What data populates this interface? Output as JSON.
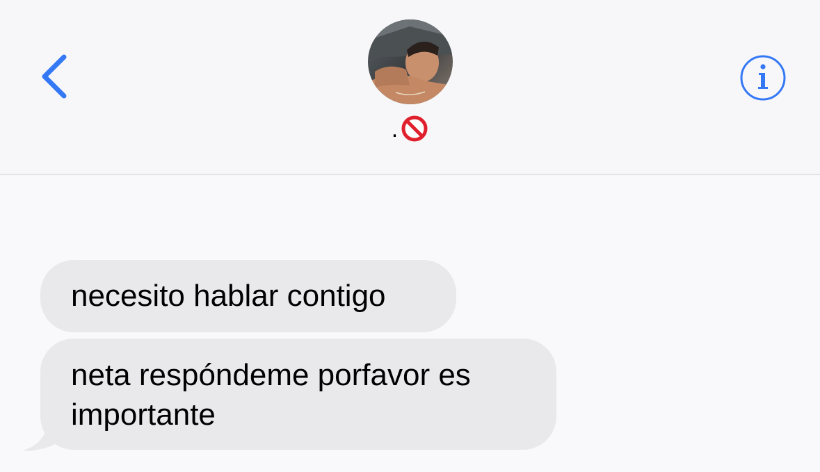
{
  "header": {
    "contact_name_prefix": ".",
    "contact_name_emoji_icon": "no-entry-sign-icon",
    "back_icon": "chevron-left-icon",
    "info_icon": "info-circle-icon"
  },
  "messages": [
    {
      "direction": "incoming",
      "text": "necesito hablar contigo"
    },
    {
      "direction": "incoming",
      "text": "neta respóndeme porfavor es importante"
    }
  ],
  "colors": {
    "accent": "#3478f6",
    "incoming_bubble": "#e9e9eb",
    "background": "#f9f9fb",
    "no_entry_red": "#e0202c"
  }
}
